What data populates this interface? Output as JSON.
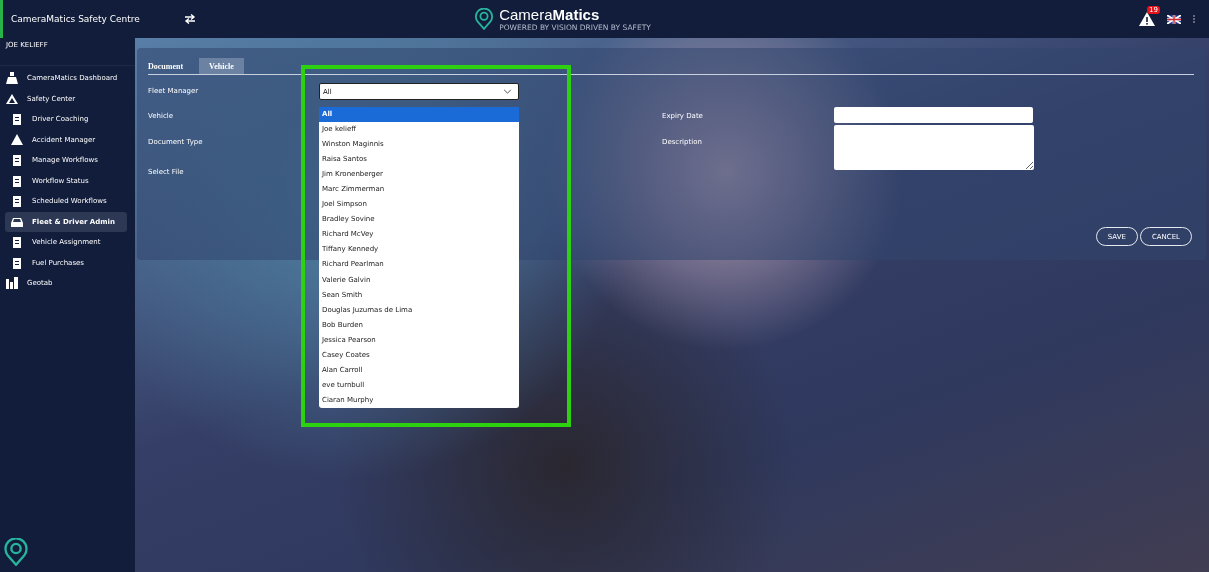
{
  "header": {
    "app_title": "CameraMatics Safety Centre",
    "brand_light": "Camera",
    "brand_bold": "Matics",
    "tagline": "POWERED BY VISION DRIVEN BY SAFETY",
    "alert_count": "19"
  },
  "sidebar": {
    "user": "JOE KELIEFF",
    "items": [
      {
        "label": "CameraMatics Dashboard",
        "selected": false
      },
      {
        "label": "Safety Center",
        "selected": false,
        "children": [
          {
            "label": "Driver Coaching",
            "selected": false
          },
          {
            "label": "Accident Manager",
            "selected": false
          },
          {
            "label": "Manage Workflows",
            "selected": false
          },
          {
            "label": "Workflow Status",
            "selected": false
          },
          {
            "label": "Scheduled Workflows",
            "selected": false
          },
          {
            "label": "Fleet & Driver Admin",
            "selected": true
          },
          {
            "label": "Vehicle Assignment",
            "selected": false
          },
          {
            "label": "Fuel Purchases",
            "selected": false
          }
        ]
      },
      {
        "label": "Geotab",
        "selected": false
      }
    ]
  },
  "tabs": [
    {
      "label": "Document",
      "selected": false
    },
    {
      "label": "Vehicle",
      "selected": true
    }
  ],
  "form": {
    "left_labels": [
      "Fleet Manager",
      "Vehicle",
      "Document Type",
      "Select File"
    ],
    "fleet_manager": {
      "value": "All",
      "options": [
        {
          "label": "All",
          "selected": true
        },
        {
          "label": "Joe kelieff",
          "selected": false
        },
        {
          "label": "Winston Maginnis",
          "selected": false
        },
        {
          "label": "Raisa Santos",
          "selected": false
        },
        {
          "label": "Jim Kronenberger",
          "selected": false
        },
        {
          "label": "Marc Zimmerman",
          "selected": false
        },
        {
          "label": "Joel Simpson",
          "selected": false
        },
        {
          "label": "Bradley Sovine",
          "selected": false
        },
        {
          "label": "Richard McVey",
          "selected": false
        },
        {
          "label": "Tiffany Kennedy",
          "selected": false
        },
        {
          "label": "Richard Pearlman",
          "selected": false
        },
        {
          "label": "Valerie Galvin",
          "selected": false
        },
        {
          "label": "Sean Smith",
          "selected": false
        },
        {
          "label": "Douglas Juzumas de Lima",
          "selected": false
        },
        {
          "label": "Bob Burden",
          "selected": false
        },
        {
          "label": "Jessica Pearson",
          "selected": false
        },
        {
          "label": "Casey Coates",
          "selected": false
        },
        {
          "label": "Alan Carroll",
          "selected": false
        },
        {
          "label": "eve turnbull",
          "selected": false
        },
        {
          "label": "Ciaran Murphy",
          "selected": false
        }
      ]
    },
    "expiry_label": "Expiry Date",
    "description_label": "Description"
  },
  "buttons": [
    "SAVE",
    "CANCEL"
  ]
}
